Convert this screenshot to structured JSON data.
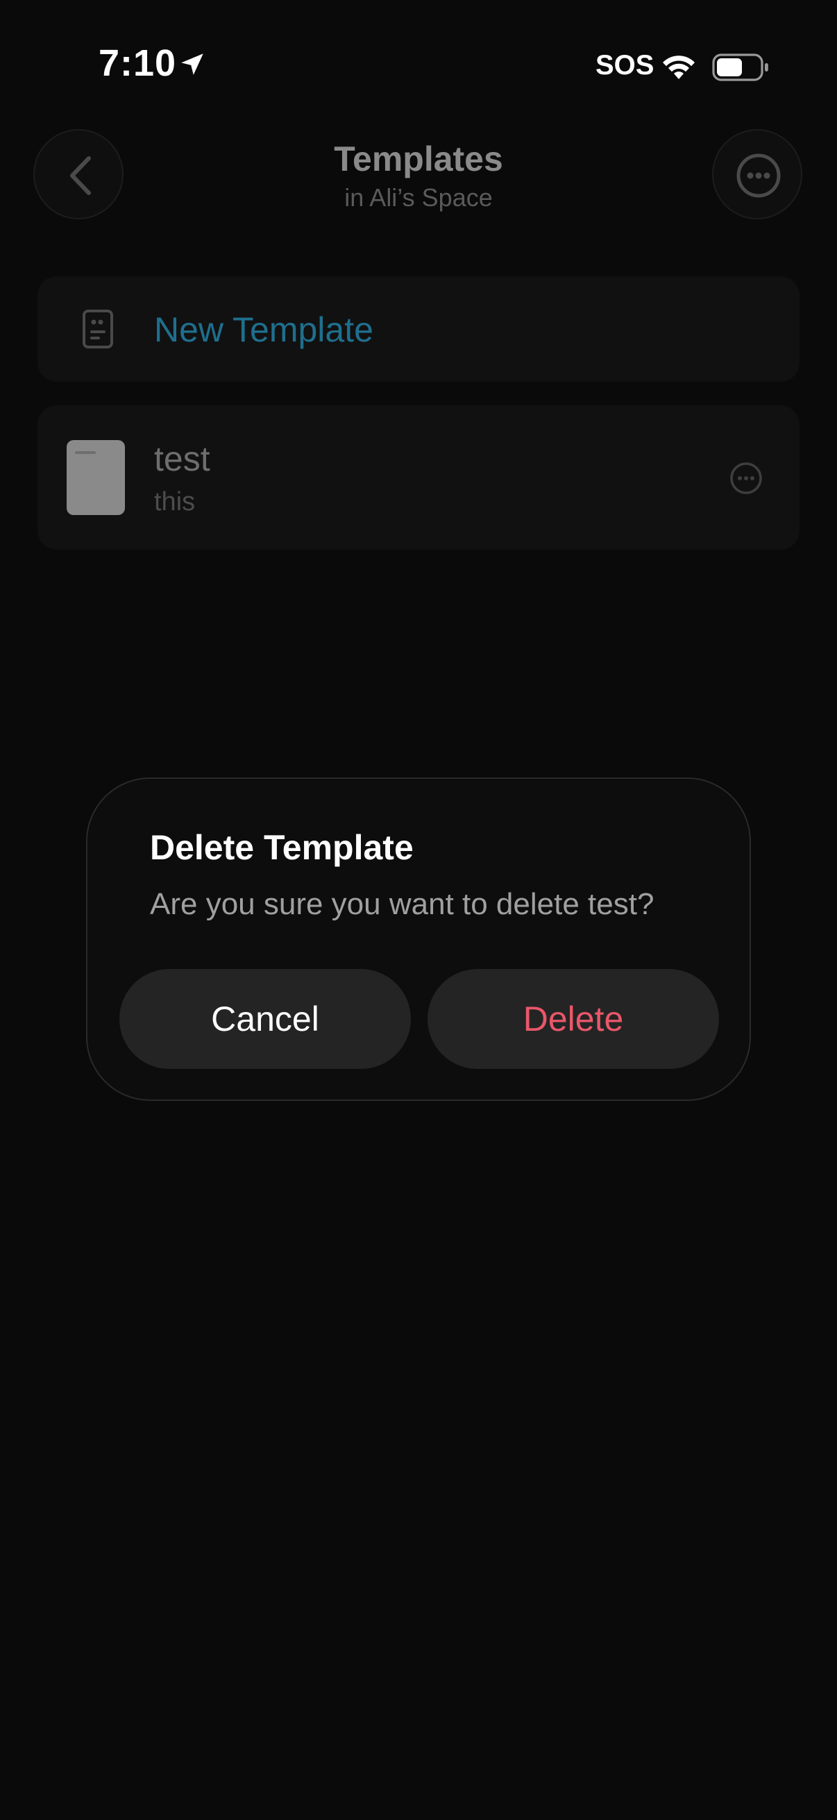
{
  "status_bar": {
    "time": "7:10",
    "carrier": "SOS"
  },
  "header": {
    "title": "Templates",
    "subtitle": "in Ali’s Space"
  },
  "new_template": {
    "label": "New Template"
  },
  "templates": [
    {
      "title": "test",
      "description": "this"
    }
  ],
  "dialog": {
    "title": "Delete Template",
    "message": "Are you sure you want to delete test?",
    "cancel_label": "Cancel",
    "delete_label": "Delete"
  },
  "colors": {
    "accent": "#1f6f8e",
    "destructive": "#e9576a",
    "background": "#0a0a0a"
  },
  "icons": {
    "back": "chevron-left-icon",
    "more": "ellipsis-circle-icon",
    "new_template": "template-document-icon",
    "location": "location-arrow-icon",
    "wifi": "wifi-icon",
    "battery": "battery-icon"
  }
}
